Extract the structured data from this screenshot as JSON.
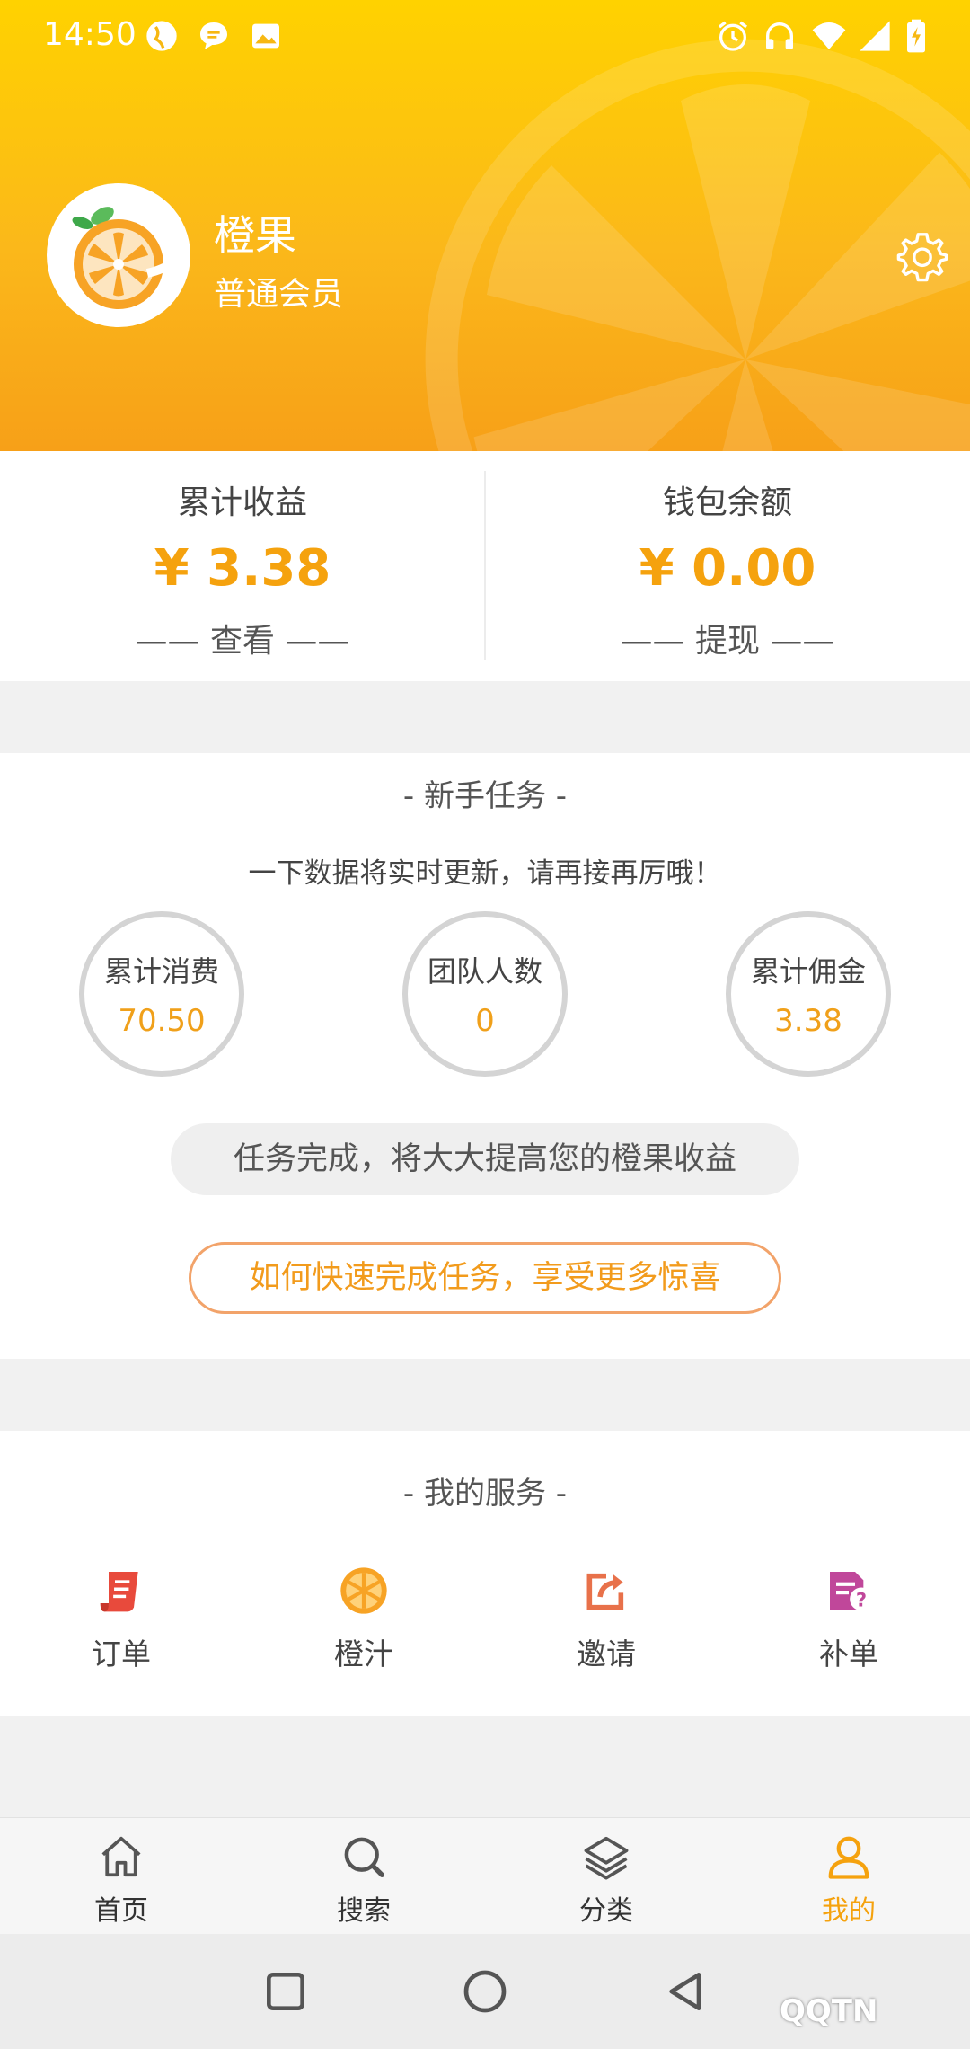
{
  "status_bar": {
    "time": "14:50",
    "left_icons": [
      "globe-icon",
      "chat-icon",
      "image-icon"
    ],
    "right_icons": [
      "alarm-icon",
      "headset-icon",
      "wifi-icon",
      "signal-icon",
      "battery-icon"
    ]
  },
  "profile": {
    "name": "橙果",
    "level": "普通会员",
    "settings_icon": "gear-icon"
  },
  "earnings": {
    "total": {
      "label": "累计收益",
      "amount": "¥ 3.38",
      "action": "—— 查看 ——"
    },
    "wallet": {
      "label": "钱包余额",
      "amount": "¥ 0.00",
      "action": "—— 提现 ——"
    }
  },
  "newbie_task": {
    "title": "- 新手任务 -",
    "subtitle": "一下数据将实时更新，请再接再厉哦！",
    "stats": [
      {
        "label": "累计消费",
        "value": "70.50"
      },
      {
        "label": "团队人数",
        "value": "0"
      },
      {
        "label": "累计佣金",
        "value": "3.38"
      }
    ],
    "hint": "任务完成，将大大提高您的橙果收益",
    "cta": "如何快速完成任务，享受更多惊喜"
  },
  "services": {
    "title": "- 我的服务 -",
    "items": [
      {
        "label": "订单",
        "icon": "order-icon"
      },
      {
        "label": "橙汁",
        "icon": "orange-icon"
      },
      {
        "label": "邀请",
        "icon": "share-icon"
      },
      {
        "label": "补单",
        "icon": "missing-order-icon"
      }
    ]
  },
  "bottom_nav": {
    "items": [
      {
        "label": "首页",
        "icon": "home-icon"
      },
      {
        "label": "搜索",
        "icon": "search-icon"
      },
      {
        "label": "分类",
        "icon": "layers-icon"
      },
      {
        "label": "我的",
        "icon": "user-icon"
      }
    ],
    "active_index": 3
  },
  "colors": {
    "accent": "#f5a20e",
    "header_top": "#ffd200",
    "header_bottom": "#f7a018"
  },
  "watermark": "QQTN"
}
